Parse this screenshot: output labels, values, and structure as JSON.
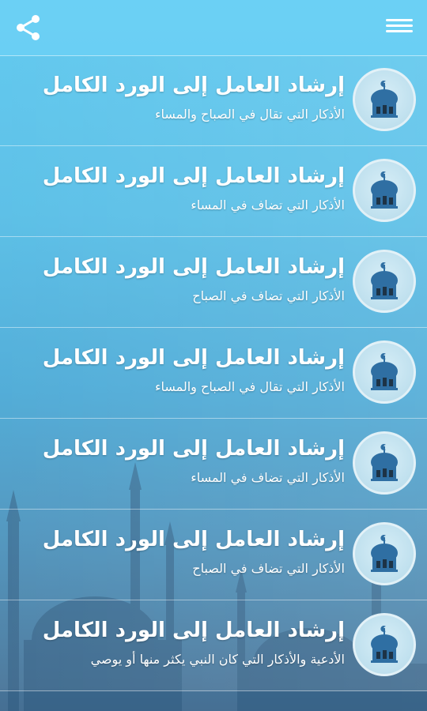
{
  "toolbar": {
    "share_icon": "share-icon",
    "menu_icon": "hamburger-menu-icon"
  },
  "colors": {
    "accent": "#5cc8ef",
    "mosque_blue": "#2f6fa3",
    "text": "#ffffff"
  },
  "items": [
    {
      "title": "إرشاد العامل إلى الورد الكامل",
      "subtitle": "الأذكار التي تقال في الصباح والمساء",
      "icon": "mosque-icon"
    },
    {
      "title": "إرشاد العامل إلى الورد الكامل",
      "subtitle": "الأذكار التي تضاف في المساء",
      "icon": "mosque-icon"
    },
    {
      "title": "إرشاد العامل إلى الورد الكامل",
      "subtitle": "الأذكار التي تضاف في الصباح",
      "icon": "mosque-icon"
    },
    {
      "title": "إرشاد العامل إلى الورد الكامل",
      "subtitle": "الأذكار التي تقال في الصباح والمساء",
      "icon": "mosque-icon"
    },
    {
      "title": "إرشاد العامل إلى الورد الكامل",
      "subtitle": "الأذكار التي تضاف في المساء",
      "icon": "mosque-icon"
    },
    {
      "title": "إرشاد العامل إلى الورد الكامل",
      "subtitle": "الأذكار التي تضاف في الصباح",
      "icon": "mosque-icon"
    },
    {
      "title": "إرشاد العامل إلى الورد الكامل",
      "subtitle": "الأدعية والأذكار التي كان النبي يكثر منها أو يوصي",
      "icon": "mosque-icon"
    }
  ]
}
